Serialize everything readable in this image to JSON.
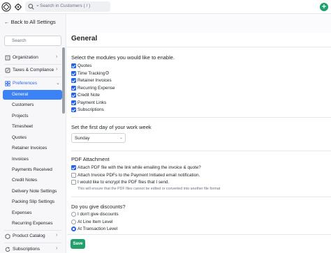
{
  "topbar": {
    "search_placeholder": "Search in Customers ( / )",
    "add_label": "+"
  },
  "sidebar": {
    "back_label": "Back to All Settings",
    "search_placeholder": "Search",
    "groups": [
      {
        "label": "Organization",
        "icon": "building-icon"
      },
      {
        "label": "Taxes & Compliance",
        "icon": "tax-icon"
      },
      {
        "label": "Preferences",
        "icon": "grid-icon"
      }
    ],
    "preferences_items": [
      "General",
      "Customers",
      "Projects",
      "Timesheet",
      "Quotes",
      "Retainer Invoices",
      "Invoices",
      "Payments Received",
      "Credit Notes",
      "Delivery Note Settings",
      "Packing Slip Settings",
      "Expenses",
      "Recurring Expenses"
    ],
    "bottom_groups": [
      {
        "label": "Product Catalog",
        "icon": "box-icon"
      },
      {
        "label": "Subscriptions",
        "icon": "refresh-icon"
      }
    ]
  },
  "main": {
    "title": "General",
    "modules": {
      "heading": "Select the modules you would like to enable.",
      "items": [
        {
          "label": "Quotes",
          "checked": true
        },
        {
          "label": "Time Tracking",
          "checked": true,
          "help": true
        },
        {
          "label": "Retainer Invoices",
          "checked": true
        },
        {
          "label": "Recurring Expense",
          "checked": true
        },
        {
          "label": "Credit Note",
          "checked": true
        },
        {
          "label": "Payment Links",
          "checked": true
        },
        {
          "label": "Subscriptions",
          "checked": true
        }
      ]
    },
    "week": {
      "heading": "Set the first day of your work week",
      "selected": "Sunday"
    },
    "pdf": {
      "heading": "PDF Attachment",
      "items": [
        {
          "label": "Attach PDF file with the link while emailing the invoice & quote?",
          "checked": true
        },
        {
          "label": "Attach Invoice PDFs to the Payment Initiated email notification.",
          "checked": false
        },
        {
          "label": "I would like to encrypt the PDF files that I send.",
          "checked": false
        }
      ],
      "note": "This will ensure that the PDF files cannot be edited or converted into another file format"
    },
    "discounts": {
      "heading": "Do you give discounts?",
      "options": [
        {
          "label": "I don't give discounts",
          "selected": false
        },
        {
          "label": "At Line Item Level",
          "selected": false
        },
        {
          "label": "At Transaction Level",
          "selected": true
        }
      ]
    },
    "save_label": "Save"
  },
  "colors": {
    "accent": "#2563eb",
    "active_nav": "#3b82f6",
    "save": "#22a06b"
  }
}
